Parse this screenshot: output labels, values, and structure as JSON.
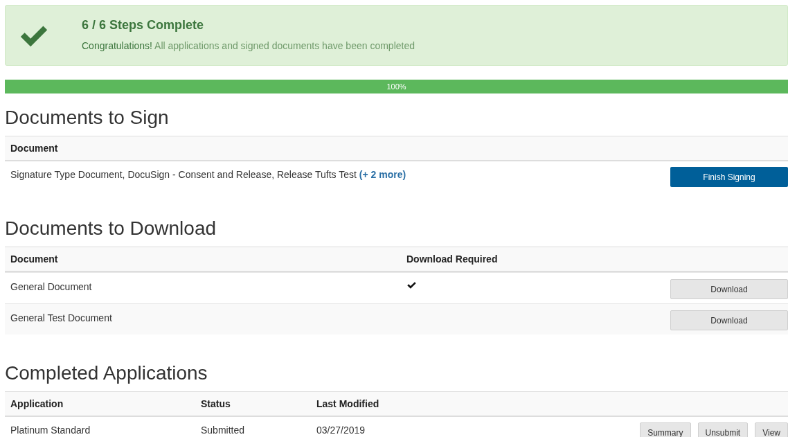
{
  "banner": {
    "title": "6 / 6 Steps Complete",
    "message_lead": "Congratulations!",
    "message": "All applications and signed documents have been completed"
  },
  "progress": {
    "level": 1,
    "label": "100%"
  },
  "sign_section": {
    "heading": "Documents to Sign",
    "columns": [
      "Document"
    ],
    "rows": [
      {
        "document": "Signature Type Document, DocuSign - Consent and Release, Release Tufts Test",
        "more_link": "(+ 2 more)",
        "action": "Finish Signing"
      }
    ]
  },
  "download_section": {
    "heading": "Documents to Download",
    "columns": [
      "Document",
      "Download Required"
    ],
    "rows": [
      {
        "document": "General Document",
        "download_required": true,
        "action": "Download"
      },
      {
        "document": "General Test Document",
        "download_required": false,
        "action": "Download"
      }
    ]
  },
  "applications_section": {
    "heading": "Completed Applications",
    "columns": [
      "Application",
      "Status",
      "Last Modified"
    ],
    "rows": [
      {
        "application": "Platinum Standard",
        "status": "Submitted",
        "last_modified": "03/27/2019",
        "actions": [
          "Summary",
          "Unsubmit",
          "View"
        ]
      }
    ]
  }
}
